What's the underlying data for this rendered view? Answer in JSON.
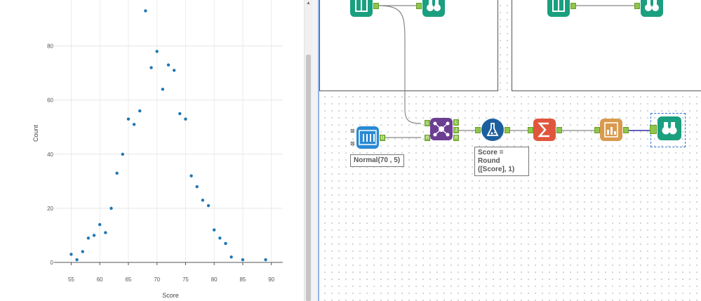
{
  "chart_data": {
    "type": "scatter",
    "xlabel": "Score",
    "ylabel": "Count",
    "xlim": [
      52,
      92
    ],
    "ylim": [
      0,
      97
    ],
    "xticks": [
      55,
      60,
      65,
      70,
      75,
      80,
      85,
      90
    ],
    "yticks": [
      0,
      20,
      40,
      60,
      80
    ],
    "grid": true,
    "marker_color": "#1f77b4",
    "points": [
      {
        "x": 55,
        "y": 3
      },
      {
        "x": 56,
        "y": 1
      },
      {
        "x": 57,
        "y": 4
      },
      {
        "x": 58,
        "y": 9
      },
      {
        "x": 59,
        "y": 10
      },
      {
        "x": 60,
        "y": 14
      },
      {
        "x": 61,
        "y": 11
      },
      {
        "x": 62,
        "y": 20
      },
      {
        "x": 63,
        "y": 33
      },
      {
        "x": 64,
        "y": 40
      },
      {
        "x": 65,
        "y": 53
      },
      {
        "x": 66,
        "y": 51
      },
      {
        "x": 67,
        "y": 56
      },
      {
        "x": 68,
        "y": 93
      },
      {
        "x": 69,
        "y": 72
      },
      {
        "x": 70,
        "y": 78
      },
      {
        "x": 71,
        "y": 64
      },
      {
        "x": 72,
        "y": 73
      },
      {
        "x": 73,
        "y": 71
      },
      {
        "x": 74,
        "y": 55
      },
      {
        "x": 75,
        "y": 53
      },
      {
        "x": 76,
        "y": 32
      },
      {
        "x": 77,
        "y": 28
      },
      {
        "x": 78,
        "y": 23
      },
      {
        "x": 79,
        "y": 21
      },
      {
        "x": 80,
        "y": 12
      },
      {
        "x": 81,
        "y": 9
      },
      {
        "x": 82,
        "y": 7
      },
      {
        "x": 83,
        "y": 2
      },
      {
        "x": 85,
        "y": 1
      },
      {
        "x": 89,
        "y": 1
      }
    ]
  },
  "workflow": {
    "annotations": {
      "normal_tool": "Normal(70 , 5)",
      "formula_line1": "Score = Round",
      "formula_line2": "([Score], 1)"
    },
    "anchors": {
      "join_left": "L",
      "join_right": "R",
      "join_out_left": "L",
      "join_out_join": "J",
      "join_out_right": "R",
      "r_out": "O"
    },
    "colors": {
      "input_teal": "#1a9f7f",
      "browse_teal": "#1a9f7f",
      "r_tool_blue": "#2b8ad3",
      "join_purple": "#6c3e93",
      "formula_blue": "#1d5f9e",
      "summarize_orange": "#e0563c",
      "report_orange": "#d99a4e",
      "connection_grey": "#888888",
      "selected_connection": "#2b2ba8"
    }
  }
}
